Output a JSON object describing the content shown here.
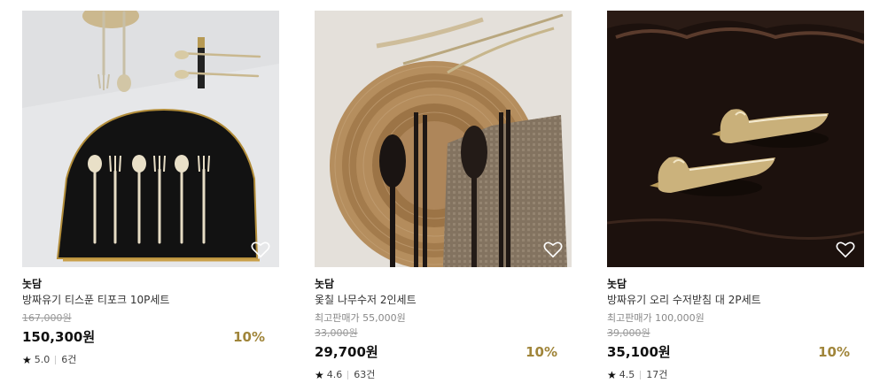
{
  "products": [
    {
      "brand": "놋담",
      "name": "방짜유기 티스푼 티포크 10P세트",
      "reference_price": "",
      "original_price": "167,000원",
      "price": "150,300원",
      "discount": "10%",
      "rating": "5.0",
      "review_count": "6건",
      "image_icon": "tableware-photo",
      "wishlist_icon": "heart-outline-icon"
    },
    {
      "brand": "놋담",
      "name": "옻칠 나무수저 2인세트",
      "reference_price": "최고판매가 55,000원",
      "original_price": "33,000원",
      "price": "29,700원",
      "discount": "10%",
      "rating": "4.6",
      "review_count": "63건",
      "image_icon": "tableware-photo",
      "wishlist_icon": "heart-outline-icon"
    },
    {
      "brand": "놋담",
      "name": "방짜유기 오리 수저받침 대 2P세트",
      "reference_price": "최고판매가 100,000원",
      "original_price": "39,000원",
      "price": "35,100원",
      "discount": "10%",
      "rating": "4.5",
      "review_count": "17건",
      "image_icon": "tableware-photo",
      "wishlist_icon": "heart-outline-icon"
    }
  ],
  "colors": {
    "discount": "#a0853a",
    "price": "#111111",
    "muted": "#999999"
  }
}
